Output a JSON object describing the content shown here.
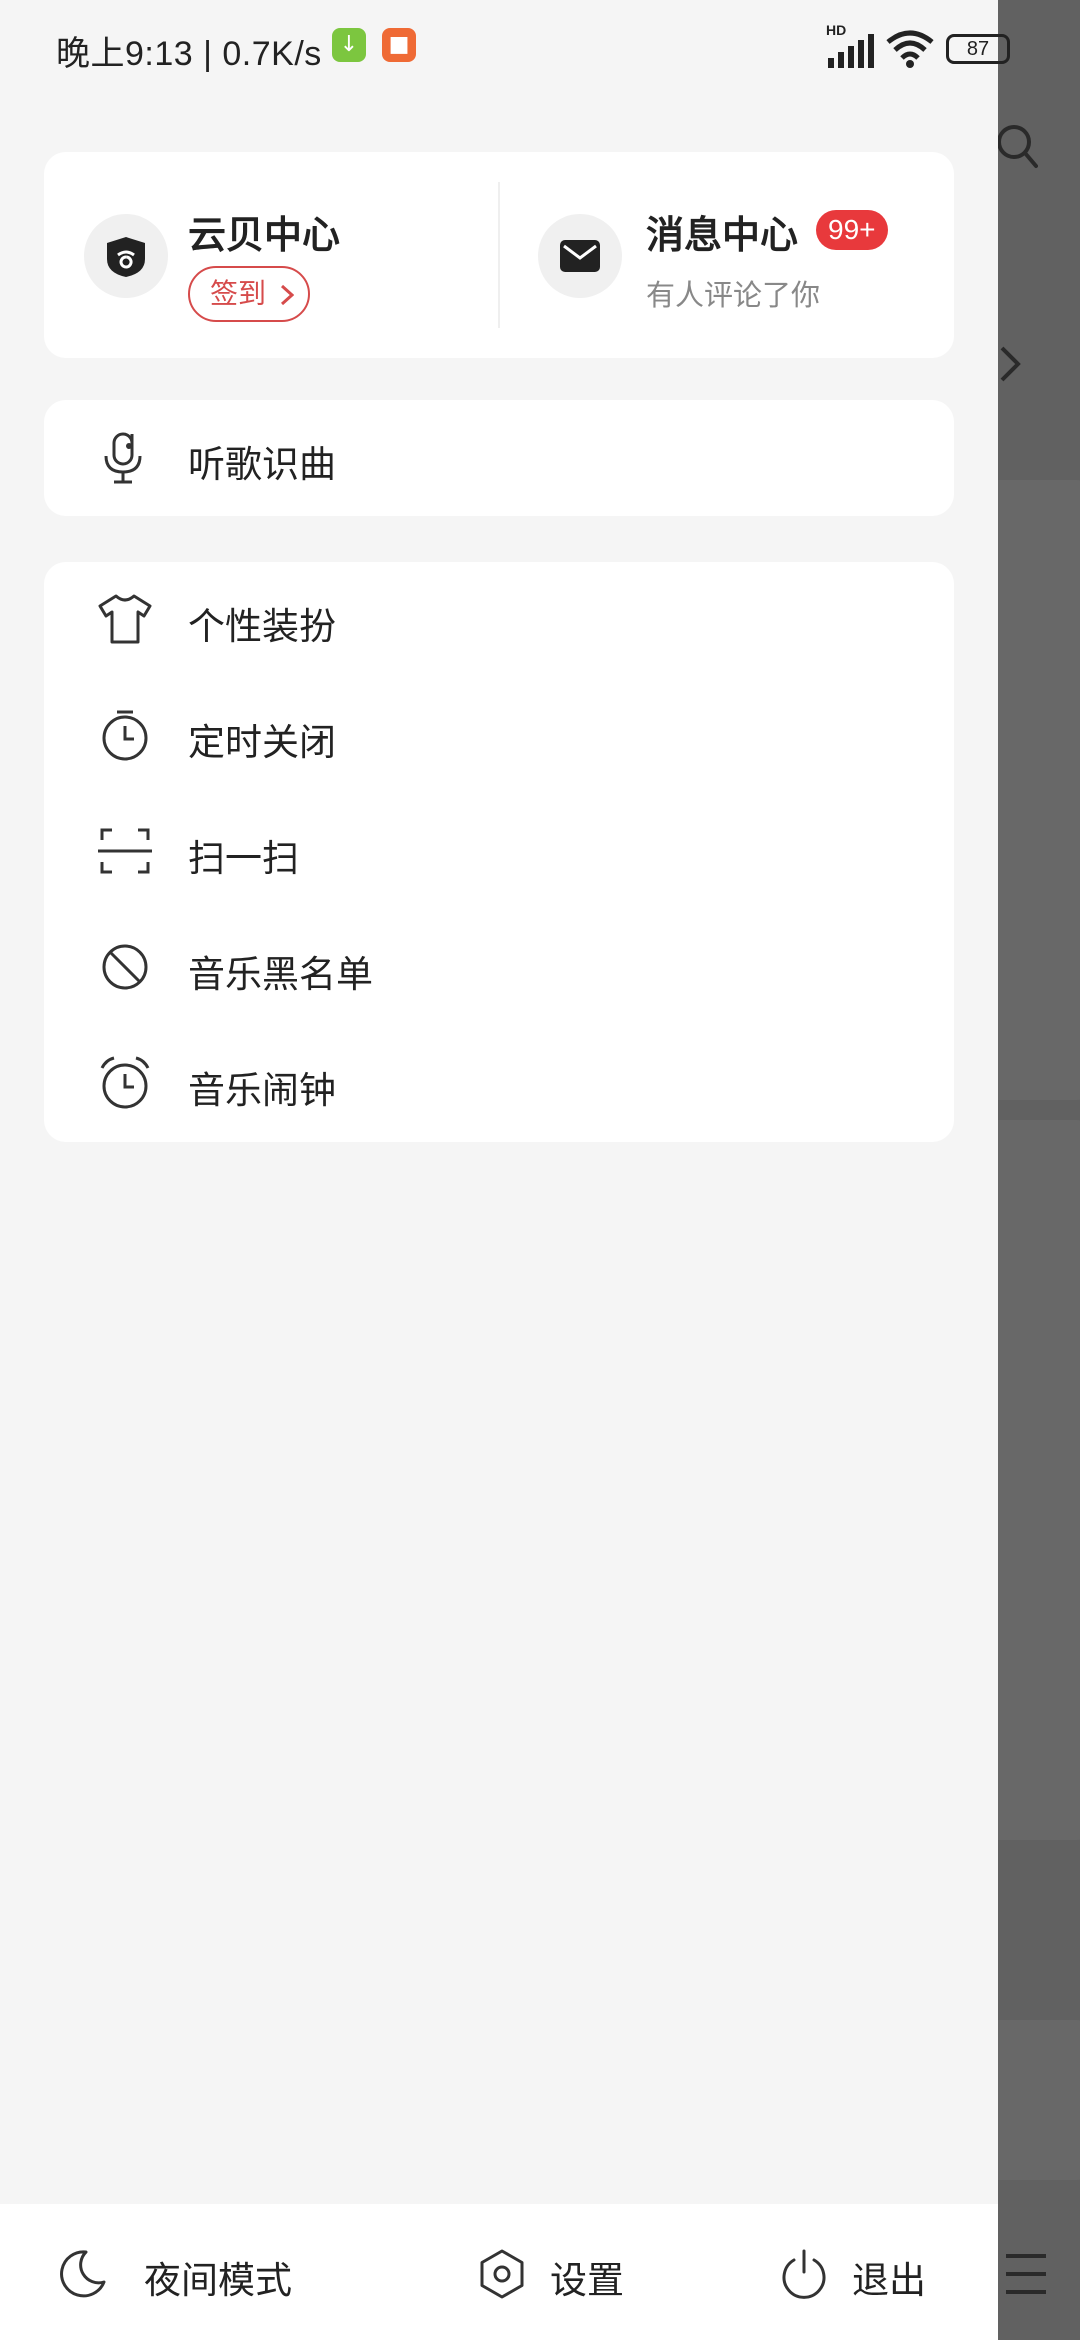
{
  "status_bar": {
    "time": "晚上9:13 | 0.7K/s",
    "network": "HD",
    "battery": "87"
  },
  "top_card": {
    "yunbei": {
      "title": "云贝中心",
      "checkin": "签到"
    },
    "messages": {
      "title": "消息中心",
      "badge": "99+",
      "subtitle": "有人评论了你"
    }
  },
  "recognize": {
    "label": "听歌识曲"
  },
  "menu": {
    "items": [
      {
        "label": "个性装扮",
        "icon": "tshirt-icon"
      },
      {
        "label": "定时关闭",
        "icon": "timer-icon"
      },
      {
        "label": "扫一扫",
        "icon": "scan-icon"
      },
      {
        "label": "音乐黑名单",
        "icon": "block-icon"
      },
      {
        "label": "音乐闹钟",
        "icon": "alarm-icon"
      }
    ]
  },
  "bottom_bar": {
    "night_mode": "夜间模式",
    "settings": "设置",
    "logout": "退出"
  },
  "colors": {
    "accent": "#e8393c",
    "checkin": "#d64b4b"
  }
}
